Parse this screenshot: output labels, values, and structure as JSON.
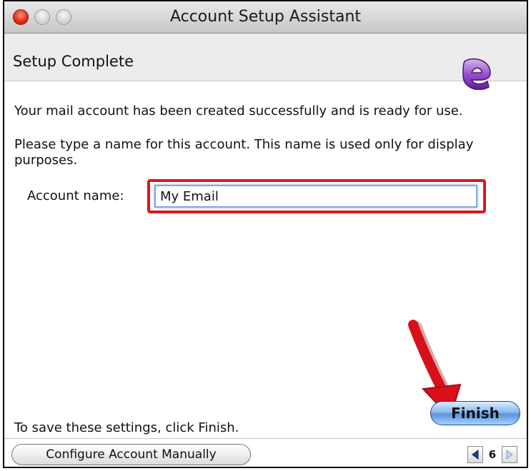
{
  "window": {
    "title": "Account Setup Assistant"
  },
  "header": {
    "step_title": "Setup Complete",
    "logo_icon": "entourage-e-logo-icon"
  },
  "content": {
    "success_message": "Your mail account has been created successfully and is ready for use.",
    "name_prompt": "Please type a name for this account. This name is used only for display purposes.",
    "account_name_label": "Account name:",
    "account_name_value": "My Email",
    "finish_hint": "To save these settings, click Finish."
  },
  "buttons": {
    "finish_label": "Finish",
    "configure_manually_label": "Configure Account Manually"
  },
  "pager": {
    "page_number": "6"
  },
  "colors": {
    "highlight": "#e1151b",
    "arrow": "#d8101b",
    "finish_button": "#5a94dc"
  }
}
